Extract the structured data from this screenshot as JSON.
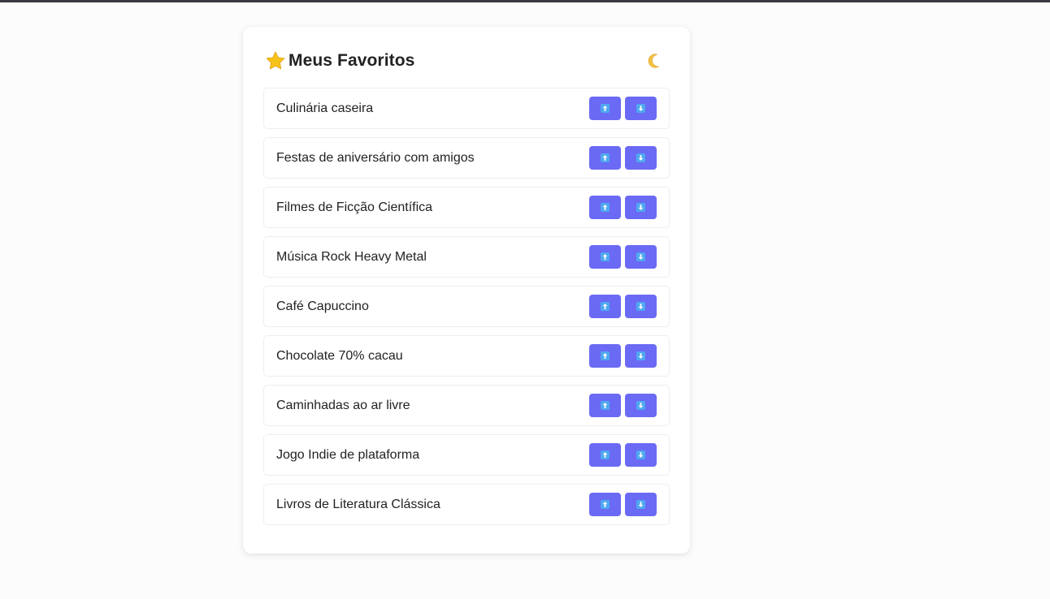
{
  "header": {
    "title": "Meus Favoritos",
    "title_icon": "star-icon",
    "theme_toggle_icon": "moon-icon"
  },
  "colors": {
    "accent": "#6a6af4",
    "arrow_icon_bg": "#4fa8f0",
    "text": "#222222",
    "border": "#eeeeee"
  },
  "favorites": [
    {
      "label": "Culinária caseira"
    },
    {
      "label": "Festas de aniversário com amigos"
    },
    {
      "label": "Filmes de Ficção Científica"
    },
    {
      "label": "Música Rock Heavy Metal"
    },
    {
      "label": "Café Capuccino"
    },
    {
      "label": "Chocolate 70% cacau"
    },
    {
      "label": "Caminhadas ao ar livre"
    },
    {
      "label": "Jogo Indie de plataforma"
    },
    {
      "label": "Livros de Literatura Clássica"
    }
  ],
  "controls": {
    "up_icon": "arrow-up-icon",
    "down_icon": "arrow-down-icon"
  }
}
